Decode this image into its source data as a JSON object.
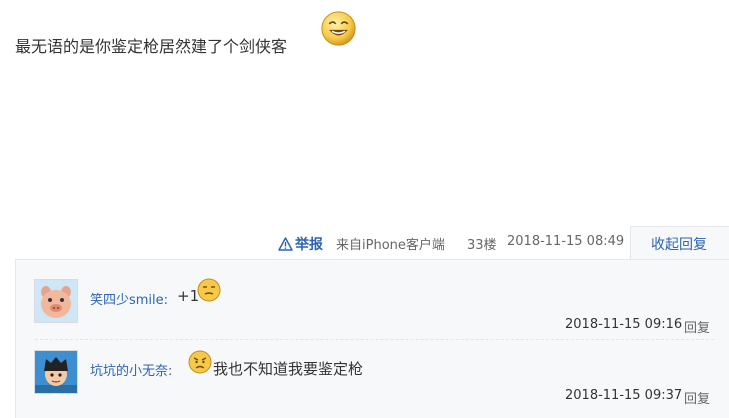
{
  "post": {
    "text": "最无语的是你鉴定枪居然建了个剑侠客",
    "emoji_icon": "grin-emoji-icon"
  },
  "meta": {
    "report_label": "举报",
    "source": "来自iPhone客户端",
    "floor": "33楼",
    "time": "2018-11-15 08:49",
    "collapse_label": "收起回复"
  },
  "replies": [
    {
      "user": "笑四少smile:",
      "text": "+1",
      "emoji_icon": "smirk-emoji-icon",
      "time": "2018-11-15 09:16",
      "reply_label": "回复",
      "avatar_icon": "pig-avatar-icon"
    },
    {
      "user": "坑坑的小无奈:",
      "text": "我也不知道我要鉴定枪",
      "emoji_icon": "sad-emoji-icon",
      "time": "2018-11-15 09:37",
      "reply_label": "回复",
      "avatar_icon": "cartoon-boy-avatar-icon"
    }
  ],
  "colors": {
    "link": "#2d64b3",
    "panel_bg": "#f7f8fa",
    "text": "#333333",
    "muted": "#666666"
  }
}
